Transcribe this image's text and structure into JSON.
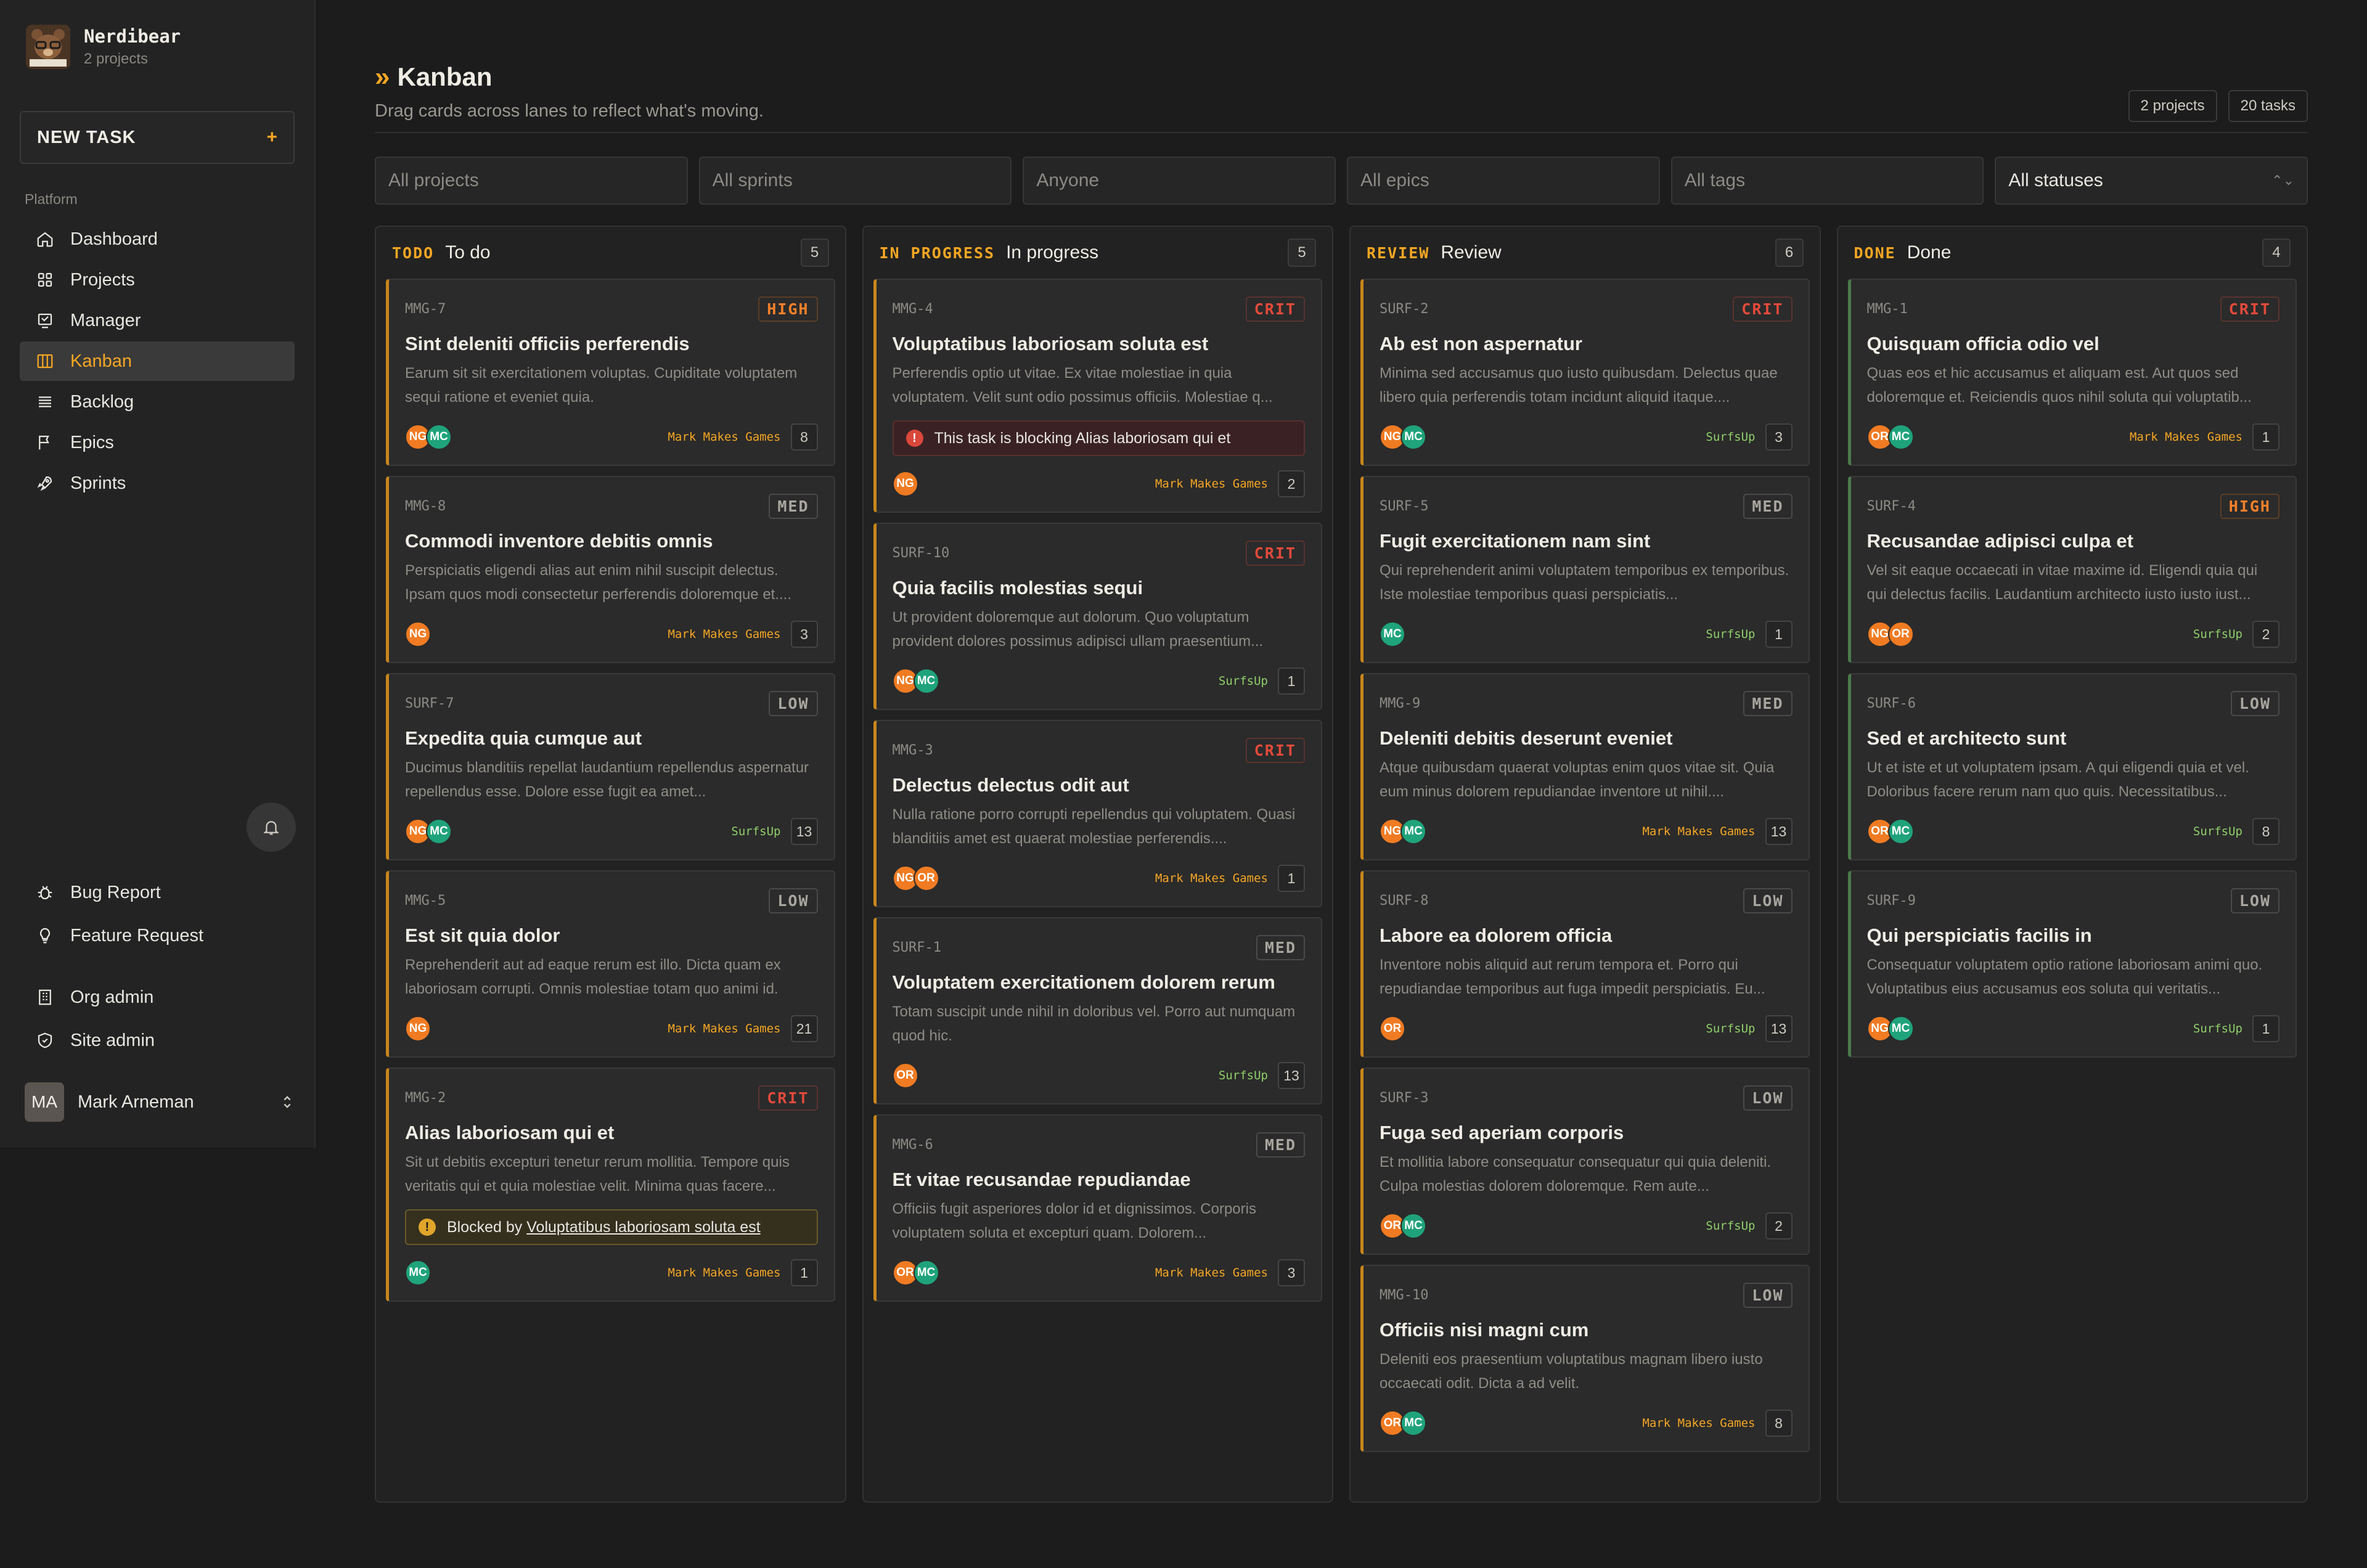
{
  "brand": {
    "name": "Nerdibear",
    "sub": "2 projects"
  },
  "sidebar": {
    "new_task": "NEW TASK",
    "section": "Platform",
    "items": [
      {
        "label": "Dashboard",
        "icon": "home-icon"
      },
      {
        "label": "Projects",
        "icon": "grid-icon"
      },
      {
        "label": "Manager",
        "icon": "inbox-icon"
      },
      {
        "label": "Kanban",
        "icon": "columns-icon"
      },
      {
        "label": "Backlog",
        "icon": "list-icon"
      },
      {
        "label": "Epics",
        "icon": "flag-icon"
      },
      {
        "label": "Sprints",
        "icon": "rocket-icon"
      }
    ],
    "bottom": [
      {
        "label": "Bug Report",
        "icon": "bug-icon"
      },
      {
        "label": "Feature Request",
        "icon": "lightbulb-icon"
      },
      {
        "label": "Org admin",
        "icon": "building-icon"
      },
      {
        "label": "Site admin",
        "icon": "shield-icon"
      }
    ],
    "user": {
      "initials": "MA",
      "name": "Mark Arneman"
    }
  },
  "header": {
    "title": "Kanban",
    "subtitle": "Drag cards across lanes to reflect what's moving.",
    "pill_projects": "2 projects",
    "pill_tasks": "20 tasks"
  },
  "filters": {
    "projects": "All projects",
    "sprints": "All sprints",
    "assignee": "Anyone",
    "epics": "All epics",
    "tags": "All tags",
    "statuses": "All statuses"
  },
  "colors": {
    "accent": "#f5a623",
    "crit": "#e24a3b",
    "high": "#f5802a",
    "surf": "#8fd06a",
    "mc": "#1fa37a",
    "ng": "#f07b22"
  },
  "lanes": [
    {
      "code": "TODO",
      "name": "To do",
      "count": "5",
      "cards": [
        {
          "id": "MMG-7",
          "prio": "HIGH",
          "title": "Sint deleniti officiis perferendis",
          "desc": "Earum sit sit exercitationem voluptas. Cupiditate voluptatem sequi ratione et eveniet quia.",
          "avatars": [
            "NG",
            "MC"
          ],
          "project": "Mark Makes Games",
          "points": "8"
        },
        {
          "id": "MMG-8",
          "prio": "MED",
          "title": "Commodi inventore debitis omnis",
          "desc": "Perspiciatis eligendi alias aut enim nihil suscipit delectus. Ipsam quos modi consectetur perferendis doloremque et....",
          "avatars": [
            "NG"
          ],
          "project": "Mark Makes Games",
          "points": "3"
        },
        {
          "id": "SURF-7",
          "prio": "LOW",
          "title": "Expedita quia cumque aut",
          "desc": "Ducimus blanditiis repellat laudantium repellendus aspernatur repellendus esse. Dolore esse fugit ea amet...",
          "avatars": [
            "NG",
            "MC"
          ],
          "project": "SurfsUp",
          "points": "13"
        },
        {
          "id": "MMG-5",
          "prio": "LOW",
          "title": "Est sit quia dolor",
          "desc": "Reprehenderit aut ad eaque rerum est illo. Dicta quam ex laboriosam corrupti. Omnis molestiae totam quo animi id.",
          "avatars": [
            "NG"
          ],
          "project": "Mark Makes Games",
          "points": "21"
        },
        {
          "id": "MMG-2",
          "prio": "CRIT",
          "title": "Alias laboriosam qui et",
          "desc": "Sit ut debitis excepturi tenetur rerum mollitia. Tempore quis veritatis qui et quia molestiae velit. Minima quas facere...",
          "blocker": {
            "kind": "amber",
            "prefix": "Blocked by ",
            "link": "Voluptatibus laboriosam soluta est"
          },
          "avatars": [
            "MC"
          ],
          "project": "Mark Makes Games",
          "points": "1"
        }
      ]
    },
    {
      "code": "IN PROGRESS",
      "name": "In progress",
      "count": "5",
      "cards": [
        {
          "id": "MMG-4",
          "prio": "CRIT",
          "title": "Voluptatibus laboriosam soluta est",
          "desc": "Perferendis optio ut vitae. Ex vitae molestiae in quia voluptatem. Velit sunt odio possimus officiis. Molestiae q...",
          "blocker": {
            "kind": "red",
            "prefix": "This task is blocking Alias laboriosam qui et",
            "link": ""
          },
          "avatars": [
            "NG"
          ],
          "project": "Mark Makes Games",
          "points": "2"
        },
        {
          "id": "SURF-10",
          "prio": "CRIT",
          "title": "Quia facilis molestias sequi",
          "desc": "Ut provident doloremque aut dolorum. Quo voluptatum provident dolores possimus adipisci ullam praesentium...",
          "avatars": [
            "NG",
            "MC"
          ],
          "project": "SurfsUp",
          "points": "1"
        },
        {
          "id": "MMG-3",
          "prio": "CRIT",
          "title": "Delectus delectus odit aut",
          "desc": "Nulla ratione porro corrupti repellendus qui voluptatem. Quasi blanditiis amet est quaerat molestiae perferendis....",
          "avatars": [
            "NG",
            "OR"
          ],
          "project": "Mark Makes Games",
          "points": "1"
        },
        {
          "id": "SURF-1",
          "prio": "MED",
          "title": "Voluptatem exercitationem dolorem rerum",
          "desc": "Totam suscipit unde nihil in doloribus vel. Porro aut numquam quod hic.",
          "avatars": [
            "OR"
          ],
          "project": "SurfsUp",
          "points": "13"
        },
        {
          "id": "MMG-6",
          "prio": "MED",
          "title": "Et vitae recusandae repudiandae",
          "desc": "Officiis fugit asperiores dolor id et dignissimos. Corporis voluptatem soluta et excepturi quam. Dolorem...",
          "avatars": [
            "OR",
            "MC"
          ],
          "project": "Mark Makes Games",
          "points": "3"
        }
      ]
    },
    {
      "code": "REVIEW",
      "name": "Review",
      "count": "6",
      "cards": [
        {
          "id": "SURF-2",
          "prio": "CRIT",
          "title": "Ab est non aspernatur",
          "desc": "Minima sed accusamus quo iusto quibusdam. Delectus quae libero quia perferendis totam incidunt aliquid itaque....",
          "avatars": [
            "NG",
            "MC"
          ],
          "project": "SurfsUp",
          "points": "3"
        },
        {
          "id": "SURF-5",
          "prio": "MED",
          "title": "Fugit exercitationem nam sint",
          "desc": "Qui reprehenderit animi voluptatem temporibus ex temporibus. Iste molestiae temporibus quasi perspiciatis...",
          "avatars": [
            "MC"
          ],
          "project": "SurfsUp",
          "points": "1"
        },
        {
          "id": "MMG-9",
          "prio": "MED",
          "title": "Deleniti debitis deserunt eveniet",
          "desc": "Atque quibusdam quaerat voluptas enim quos vitae sit. Quia eum minus dolorem repudiandae inventore ut nihil....",
          "avatars": [
            "NG",
            "MC"
          ],
          "project": "Mark Makes Games",
          "points": "13"
        },
        {
          "id": "SURF-8",
          "prio": "LOW",
          "title": "Labore ea dolorem officia",
          "desc": "Inventore nobis aliquid aut rerum tempora et. Porro qui repudiandae temporibus aut fuga impedit perspiciatis. Eu...",
          "avatars": [
            "OR"
          ],
          "project": "SurfsUp",
          "points": "13"
        },
        {
          "id": "SURF-3",
          "prio": "LOW",
          "title": "Fuga sed aperiam corporis",
          "desc": "Et mollitia labore consequatur consequatur qui quia deleniti. Culpa molestias dolorem doloremque. Rem aute...",
          "avatars": [
            "OR",
            "MC"
          ],
          "project": "SurfsUp",
          "points": "2"
        },
        {
          "id": "MMG-10",
          "prio": "LOW",
          "title": "Officiis nisi magni cum",
          "desc": "Deleniti eos praesentium voluptatibus magnam libero iusto occaecati odit. Dicta a ad velit.",
          "avatars": [
            "OR",
            "MC"
          ],
          "project": "Mark Makes Games",
          "points": "8"
        }
      ]
    },
    {
      "code": "DONE",
      "name": "Done",
      "count": "4",
      "cards": [
        {
          "id": "MMG-1",
          "prio": "CRIT",
          "title": "Quisquam officia odio vel",
          "desc": "Quas eos et hic accusamus et aliquam est. Aut quos sed doloremque et. Reiciendis quos nihil soluta qui voluptatib...",
          "avatars": [
            "OR",
            "MC"
          ],
          "project": "Mark Makes Games",
          "points": "1"
        },
        {
          "id": "SURF-4",
          "prio": "HIGH",
          "title": "Recusandae adipisci culpa et",
          "desc": "Vel sit eaque occaecati in vitae maxime id. Eligendi quia qui qui delectus facilis. Laudantium architecto iusto iusto iust...",
          "avatars": [
            "NG",
            "OR"
          ],
          "project": "SurfsUp",
          "points": "2"
        },
        {
          "id": "SURF-6",
          "prio": "LOW",
          "title": "Sed et architecto sunt",
          "desc": "Ut et iste et ut voluptatem ipsam. A qui eligendi quia et vel. Doloribus facere rerum nam quo quis. Necessitatibus...",
          "avatars": [
            "OR",
            "MC"
          ],
          "project": "SurfsUp",
          "points": "8"
        },
        {
          "id": "SURF-9",
          "prio": "LOW",
          "title": "Qui perspiciatis facilis in",
          "desc": "Consequatur voluptatem optio ratione laboriosam animi quo. Voluptatibus eius accusamus eos soluta qui veritatis...",
          "avatars": [
            "NG",
            "MC"
          ],
          "project": "SurfsUp",
          "points": "1"
        }
      ]
    }
  ]
}
